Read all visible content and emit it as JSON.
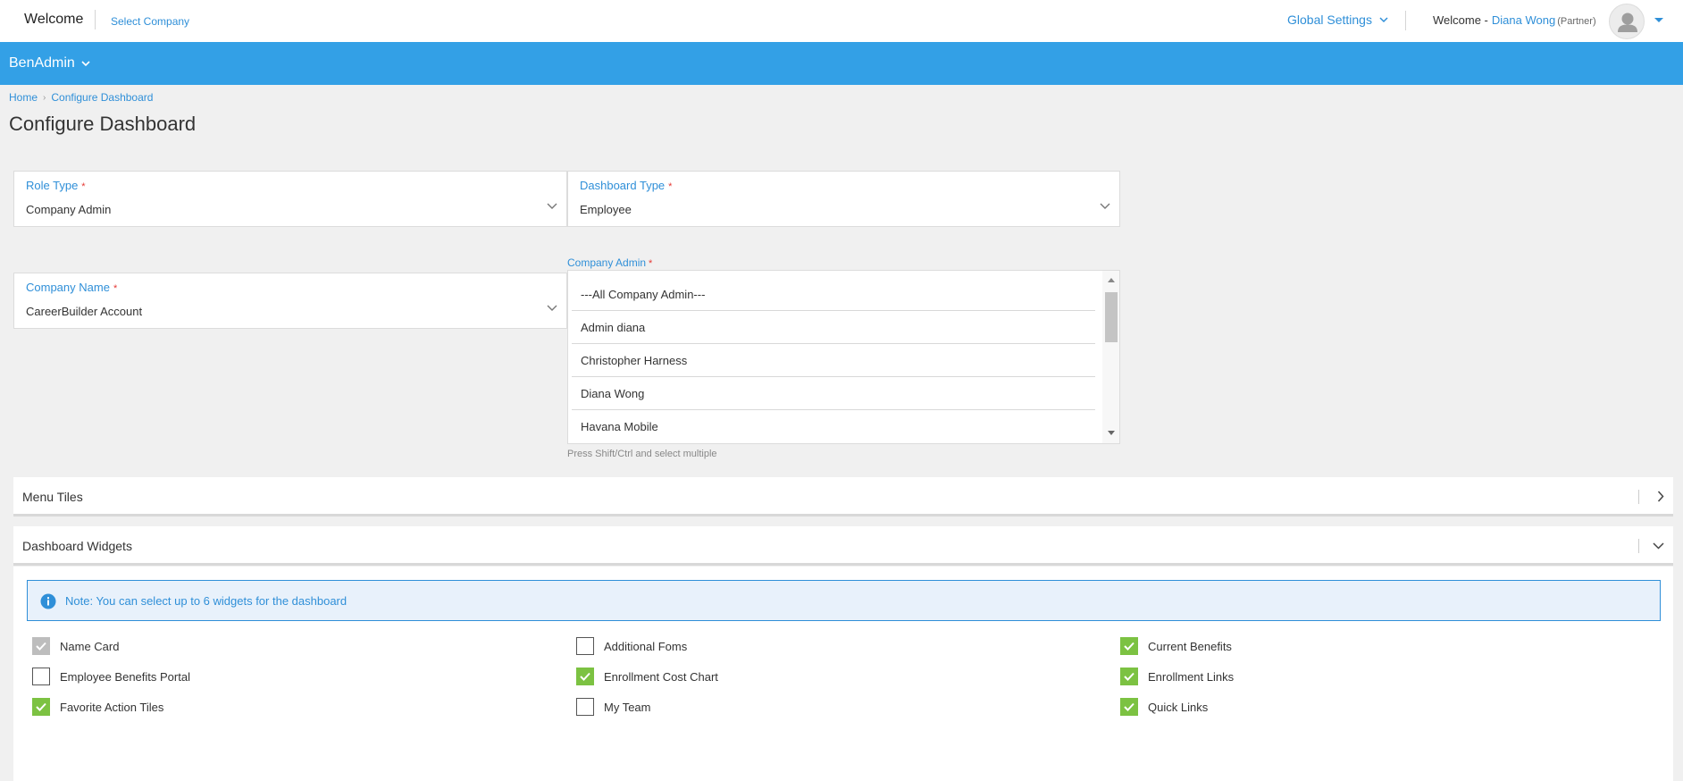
{
  "header": {
    "welcome": "Welcome",
    "select_company": "Select Company",
    "global_settings": "Global Settings",
    "welcome_user_prefix": "Welcome -",
    "user_name": "Diana Wong",
    "user_role": "(Partner)"
  },
  "nav": {
    "app_menu": "BenAdmin"
  },
  "breadcrumb": {
    "home": "Home",
    "current": "Configure Dashboard"
  },
  "page_title": "Configure Dashboard",
  "form": {
    "role_type": {
      "label": "Role Type",
      "required": "*",
      "value": "Company Admin"
    },
    "dashboard_type": {
      "label": "Dashboard Type",
      "required": "*",
      "value": "Employee"
    },
    "company_name": {
      "label": "Company Name",
      "required": "*",
      "value": "CareerBuilder Account"
    },
    "company_admin": {
      "label": "Company Admin",
      "required": "*",
      "options": [
        "---All Company Admin---",
        "Admin diana",
        "Christopher Harness",
        "Diana Wong",
        "Havana Mobile"
      ],
      "hint": "Press Shift/Ctrl and select multiple"
    }
  },
  "panels": {
    "menu_tiles": {
      "title": "Menu Tiles"
    },
    "dashboard_widgets": {
      "title": "Dashboard Widgets",
      "note": "Note: You can select up to 6 widgets for the dashboard",
      "widgets": [
        {
          "label": "Name Card",
          "state": "disabled-checked"
        },
        {
          "label": "Employee Benefits Portal",
          "state": "unchecked"
        },
        {
          "label": "Favorite Action Tiles",
          "state": "checked"
        },
        {
          "label": "Additional Foms",
          "state": "unchecked"
        },
        {
          "label": "Enrollment Cost Chart",
          "state": "checked"
        },
        {
          "label": "My Team",
          "state": "unchecked"
        },
        {
          "label": "Current Benefits",
          "state": "checked"
        },
        {
          "label": "Enrollment Links",
          "state": "checked"
        },
        {
          "label": "Quick Links",
          "state": "checked"
        }
      ]
    }
  },
  "colors": {
    "accent": "#2f8fd8",
    "navbar": "#33a0e6",
    "checked": "#7cc242",
    "required": "#e53935"
  }
}
